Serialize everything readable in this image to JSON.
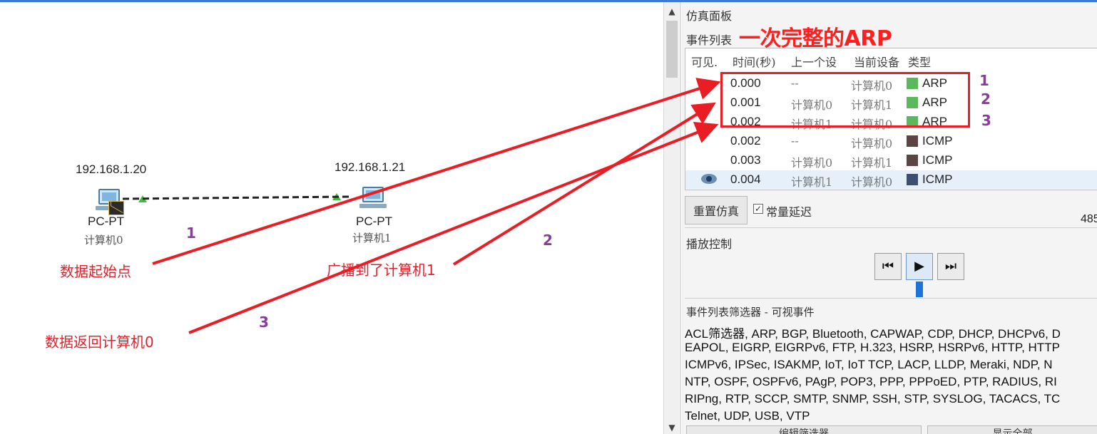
{
  "workspace": {
    "devices": [
      {
        "ip": "192.168.1.20",
        "type": "PC-PT",
        "name": "计算机0"
      },
      {
        "ip": "192.168.1.21",
        "type": "PC-PT",
        "name": "计算机1"
      }
    ],
    "annotations": {
      "origin": "数据起始点",
      "broadcast": "广播到了计算机1",
      "return": "数据返回计算机0"
    },
    "step_labels": [
      "1",
      "2",
      "3"
    ]
  },
  "panel": {
    "title": "仿真面板",
    "event_list_title": "事件列表",
    "caption": "一次完整的ARP",
    "columns": [
      "可见.",
      "时间(秒)",
      "上一个设",
      "当前设备",
      "类型"
    ],
    "events": [
      {
        "time": "0.000",
        "last": "--",
        "at": "计算机0",
        "type": "ARP",
        "color": "#5cb85c"
      },
      {
        "time": "0.001",
        "last": "计算机0",
        "at": "计算机1",
        "type": "ARP",
        "color": "#5cb85c"
      },
      {
        "time": "0.002",
        "last": "计算机1",
        "at": "计算机0",
        "type": "ARP",
        "color": "#5cb85c"
      },
      {
        "time": "0.002",
        "last": "--",
        "at": "计算机0",
        "type": "ICMP",
        "color": "#5a4444"
      },
      {
        "time": "0.003",
        "last": "计算机0",
        "at": "计算机1",
        "type": "ICMP",
        "color": "#5a4444"
      },
      {
        "time": "0.004",
        "last": "计算机1",
        "at": "计算机0",
        "type": "ICMP",
        "color": "#3d4f75",
        "selected": true
      }
    ],
    "box_step_labels": [
      "1",
      "2",
      "3"
    ],
    "reset_label": "重置仿真",
    "constant_delay_label": "常量延迟",
    "constant_delay_checked": true,
    "clock_partial": "485",
    "playback_title": "播放控制",
    "playback_buttons": {
      "back": "step-back-icon",
      "play": "play-icon",
      "forward": "step-forward-icon"
    },
    "filter_title": "事件列表筛选器 - 可视事件",
    "filter_lines": [
      "ACL筛选器, ARP, BGP, Bluetooth, CAPWAP, CDP, DHCP, DHCPv6, D",
      "EAPOL, EIGRP, EIGRPv6, FTP, H.323, HSRP, HSRPv6, HTTP, HTTP",
      "ICMPv6, IPSec, ISAKMP, IoT, IoT TCP, LACP, LLDP, Meraki, NDP, N",
      "NTP, OSPF, OSPFv6, PAgP, POP3, PPP, PPPoED, PTP, RADIUS, RI",
      "RIPng, RTP, SCCP, SMTP, SNMP, SSH, STP, SYSLOG, TACACS, TC",
      "Telnet, UDP, USB, VTP"
    ],
    "bottom_buttons": [
      "编辑筛选器",
      "显示全部"
    ]
  }
}
